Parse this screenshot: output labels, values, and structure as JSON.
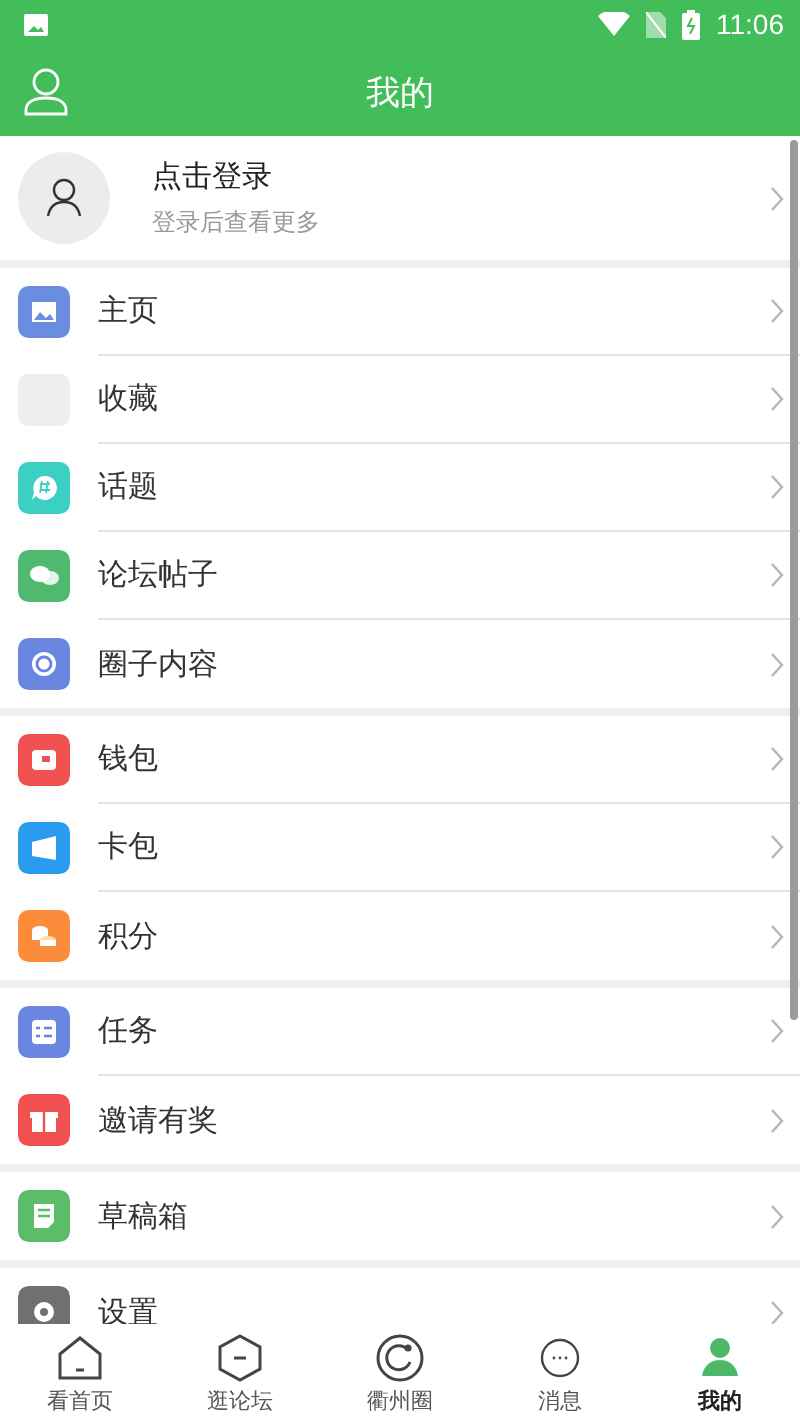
{
  "status_bar": {
    "time": "11:06"
  },
  "header": {
    "title": "我的"
  },
  "profile": {
    "name": "点击登录",
    "hint": "登录后查看更多"
  },
  "groups": [
    {
      "items": [
        {
          "label": "主页",
          "color": "#6a8de0"
        },
        {
          "label": "收藏",
          "color": "#eeeeee"
        },
        {
          "label": "话题",
          "color": "#3ccfc4"
        },
        {
          "label": "论坛帖子",
          "color": "#4fba6f"
        },
        {
          "label": "圈子内容",
          "color": "#6a86e0"
        }
      ]
    },
    {
      "items": [
        {
          "label": "钱包",
          "color": "#f05050"
        },
        {
          "label": "卡包",
          "color": "#2a9cf0"
        },
        {
          "label": "积分",
          "color": "#fb8c3c"
        }
      ]
    },
    {
      "items": [
        {
          "label": "任务",
          "color": "#6a86e0"
        },
        {
          "label": "邀请有奖",
          "color": "#f05050"
        }
      ]
    },
    {
      "items": [
        {
          "label": "草稿箱",
          "color": "#5bbd6a"
        }
      ]
    },
    {
      "items": [
        {
          "label": "设置",
          "color": "#707070"
        }
      ]
    }
  ],
  "tabs": [
    {
      "label": "看首页",
      "selected": false
    },
    {
      "label": "逛论坛",
      "selected": false
    },
    {
      "label": "衢州圈",
      "selected": false
    },
    {
      "label": "消息",
      "selected": false
    },
    {
      "label": "我的",
      "selected": true
    }
  ]
}
